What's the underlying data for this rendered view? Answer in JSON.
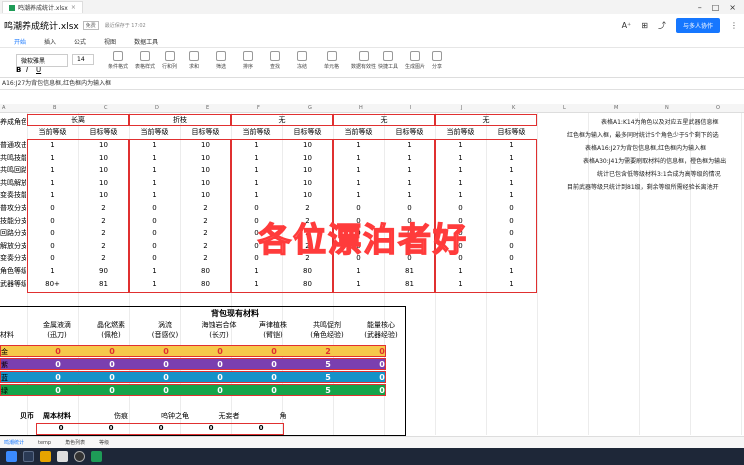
{
  "browser_tab": {
    "title": "鸣潮养成统计.xlsx"
  },
  "doc": {
    "title": "鸣潮养成统计.xlsx",
    "badge": "免费",
    "save_status": "最近保存于 17:02",
    "share": "与多人协作"
  },
  "menus": [
    "开始",
    "插入",
    "公式",
    "视图",
    "数据工具"
  ],
  "ribbon": {
    "font": "微软雅黑",
    "size": "14",
    "labels": [
      "条件格式",
      "表格样式",
      "行和列",
      "求和",
      "筛选",
      "排序",
      "查找",
      "冻结",
      "单元格",
      "数据有效性",
      "快捷工具",
      "生成图片",
      "分享"
    ]
  },
  "formula_text": "A16:J27为背包信息框,红色框内为输入框",
  "columns": [
    "A",
    "B",
    "C",
    "D",
    "E",
    "F",
    "G",
    "H",
    "I",
    "J",
    "K",
    "L",
    "M",
    "N",
    "O"
  ],
  "groups": [
    "长离",
    "折枝",
    "无",
    "无",
    "无"
  ],
  "group_label": "养成角色",
  "sub_headers": [
    "当前等级",
    "目标等级"
  ],
  "rows": [
    {
      "label": "普通攻击",
      "v": [
        "1",
        "10",
        "1",
        "10",
        "1",
        "10",
        "1",
        "1",
        "1",
        "1"
      ]
    },
    {
      "label": "共鸣技能",
      "v": [
        "1",
        "10",
        "1",
        "10",
        "1",
        "10",
        "1",
        "1",
        "1",
        "1"
      ]
    },
    {
      "label": "共鸣回路",
      "v": [
        "1",
        "10",
        "1",
        "10",
        "1",
        "10",
        "1",
        "1",
        "1",
        "1"
      ]
    },
    {
      "label": "共鸣解放",
      "v": [
        "1",
        "10",
        "1",
        "10",
        "1",
        "10",
        "1",
        "1",
        "1",
        "1"
      ]
    },
    {
      "label": "变奏技能",
      "v": [
        "1",
        "10",
        "1",
        "10",
        "1",
        "10",
        "1",
        "1",
        "1",
        "1"
      ]
    },
    {
      "label": "普攻分支",
      "v": [
        "0",
        "2",
        "0",
        "2",
        "0",
        "2",
        "0",
        "0",
        "0",
        "0"
      ]
    },
    {
      "label": "技能分支",
      "v": [
        "0",
        "2",
        "0",
        "2",
        "0",
        "2",
        "0",
        "0",
        "0",
        "0"
      ]
    },
    {
      "label": "回路分支",
      "v": [
        "0",
        "2",
        "0",
        "2",
        "0",
        "2",
        "0",
        "0",
        "0",
        "0"
      ]
    },
    {
      "label": "解放分支",
      "v": [
        "0",
        "2",
        "0",
        "2",
        "0",
        "2",
        "0",
        "0",
        "0",
        "0"
      ]
    },
    {
      "label": "变奏分支",
      "v": [
        "0",
        "2",
        "0",
        "2",
        "0",
        "2",
        "0",
        "0",
        "0",
        "0"
      ]
    },
    {
      "label": "角色等级",
      "v": [
        "1",
        "90",
        "1",
        "80",
        "1",
        "80",
        "1",
        "81",
        "1",
        "1"
      ]
    },
    {
      "label": "武器等级",
      "v": [
        "80+",
        "81",
        "1",
        "80",
        "1",
        "80",
        "1",
        "81",
        "1",
        "1"
      ]
    }
  ],
  "notes": [
    "表格A1:K14为角色以及对应五星武器信息框",
    "红色框为输入框，最多同时统计5个角色少于5个剩下的选",
    "表格A16:J27为背包信息框,红色框内为输入框",
    "表格A30:J41为需要刷取材料的信息框，橙色框为输出",
    "统计已包含低等级材料3:1合成为高等级的情况",
    "目前武器等级只统计到81级，剩余等级所需经验长离池开"
  ],
  "watermark": "各位漂泊者好",
  "materials": {
    "title": "背包现有材料",
    "row_head": "材料",
    "headers": [
      [
        "金属液滴",
        "(迅刀)"
      ],
      [
        "晶化燃素",
        "(佩枪)"
      ],
      [
        "涡流",
        "(音感仪)"
      ],
      [
        "海蚀岩合体",
        "(长刃)"
      ],
      [
        "声律植株",
        "(臂铠)"
      ],
      [
        "共鸣促剂",
        "(角色经验)"
      ],
      [
        "能量核心",
        "(武器经验)"
      ]
    ],
    "rows": [
      {
        "label": "金",
        "color": "#f6c84a",
        "v": [
          "0",
          "0",
          "0",
          "0",
          "0",
          "2",
          "0"
        ]
      },
      {
        "label": "紫",
        "color": "#7a3fb0",
        "v": [
          "0",
          "0",
          "0",
          "0",
          "0",
          "5",
          "0"
        ]
      },
      {
        "label": "蓝",
        "color": "#1592c9",
        "v": [
          "0",
          "0",
          "0",
          "0",
          "0",
          "5",
          "0"
        ]
      },
      {
        "label": "绿",
        "color": "#15a34a",
        "v": [
          "0",
          "0",
          "0",
          "0",
          "0",
          "5",
          "0"
        ]
      }
    ],
    "bottom_headers": [
      "贝币",
      "周本材料",
      "伤痕",
      "呜钟之龟",
      "无妄者",
      "角"
    ],
    "bottom_values": [
      "0",
      "0",
      "0",
      "0",
      "0"
    ]
  },
  "sheet_tabs": [
    "鸣潮统计",
    "temp",
    "角色列表",
    "等级"
  ]
}
